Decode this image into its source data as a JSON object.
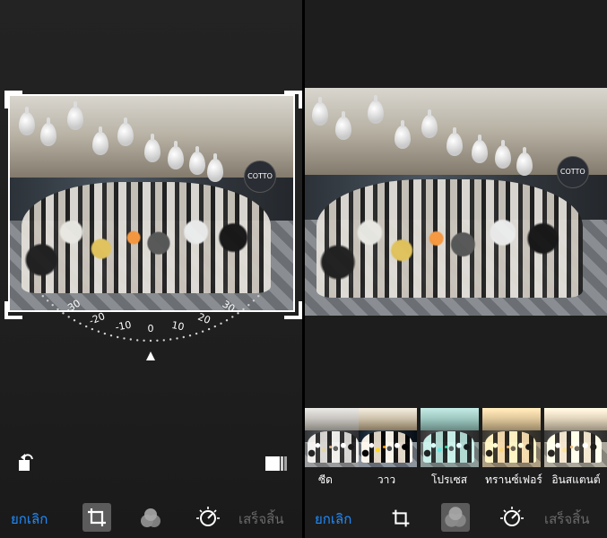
{
  "left_panel": {
    "dial": {
      "tick_labels": [
        "-30",
        "-20",
        "-10",
        "0",
        "10",
        "20",
        "30"
      ],
      "selected_angle": 0
    },
    "icons": {
      "rotate": "rotate-left-icon",
      "aspect": "aspect-ratio-icon"
    },
    "toolbar": {
      "cancel_label": "ยกเลิก",
      "done_label": "เสร็จสิ้น",
      "crop_icon": "crop-icon",
      "filters_icon": "filters-icon",
      "adjust_icon": "adjust-icon"
    }
  },
  "right_panel": {
    "filters": [
      {
        "label": "ซีด",
        "selected": false
      },
      {
        "label": "วาว",
        "selected": false
      },
      {
        "label": "โปรเซส",
        "selected": false
      },
      {
        "label": "ทรานซ์เฟอร์",
        "selected": false
      },
      {
        "label": "อินสแตนต์",
        "selected": false
      }
    ],
    "toolbar": {
      "cancel_label": "ยกเลิก",
      "done_label": "เสร็จสิ้น",
      "crop_icon": "crop-icon",
      "filters_icon": "filters-icon",
      "adjust_icon": "adjust-icon"
    }
  },
  "colors": {
    "accent": "#1f8cff",
    "disabled": "#6a6a6a",
    "toolbar_bg": "#1d1d1d"
  }
}
